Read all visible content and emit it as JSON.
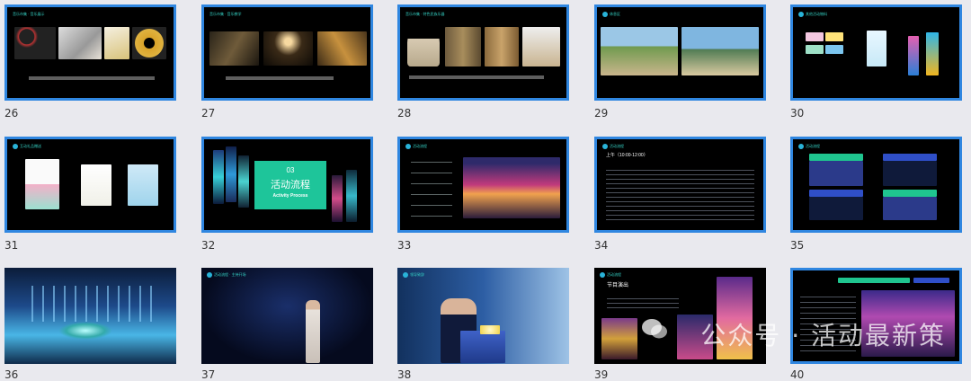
{
  "slides": [
    {
      "num": "26",
      "title": "音乐市集 · 音乐展示"
    },
    {
      "num": "27",
      "title": "音乐市集 · 音乐教学"
    },
    {
      "num": "28",
      "title": "音乐市集 · 特色民族乐器"
    },
    {
      "num": "29",
      "title": "休息区"
    },
    {
      "num": "30",
      "title": "其他活动物料"
    },
    {
      "num": "31",
      "title": "互动礼品赠送"
    },
    {
      "num": "32",
      "title": "活动流程",
      "subtitle": "Activity Process",
      "badge": "03"
    },
    {
      "num": "33",
      "title": "活动流程"
    },
    {
      "num": "34",
      "title": "活动流程",
      "heading": "上午（10:00-12:00）"
    },
    {
      "num": "35",
      "title": "活动流程"
    },
    {
      "num": "36"
    },
    {
      "num": "37",
      "title": "活动流程 · 主持开场"
    },
    {
      "num": "38",
      "title": "领导致辞"
    },
    {
      "num": "39",
      "title": "活动流程",
      "heading": "节目演出"
    },
    {
      "num": "40"
    }
  ],
  "watermark": "公众号 · 活动最新策"
}
